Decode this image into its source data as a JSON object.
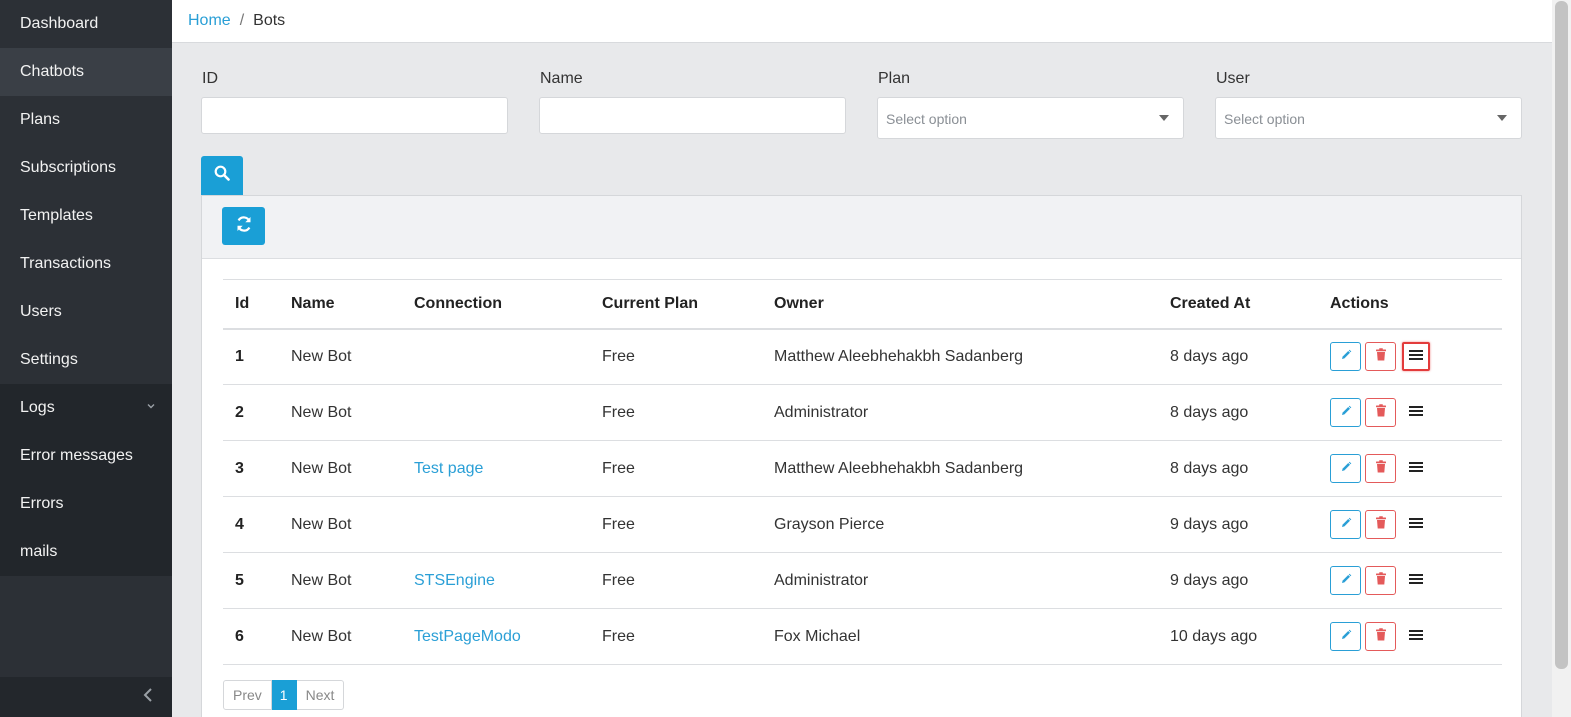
{
  "sidebar": {
    "items": [
      {
        "label": "Dashboard"
      },
      {
        "label": "Chatbots"
      },
      {
        "label": "Plans"
      },
      {
        "label": "Subscriptions"
      },
      {
        "label": "Templates"
      },
      {
        "label": "Transactions"
      },
      {
        "label": "Users"
      },
      {
        "label": "Settings"
      },
      {
        "label": "Logs"
      },
      {
        "label": "Error messages"
      },
      {
        "label": "Errors"
      },
      {
        "label": "mails"
      }
    ],
    "active": "Chatbots"
  },
  "breadcrumb": {
    "home": "Home",
    "separator": "/",
    "current": "Bots"
  },
  "filters": {
    "id_label": "ID",
    "id_value": "",
    "name_label": "Name",
    "name_value": "",
    "plan_label": "Plan",
    "plan_placeholder": "Select option",
    "user_label": "User",
    "user_placeholder": "Select option"
  },
  "table": {
    "headers": {
      "id": "Id",
      "name": "Name",
      "connection": "Connection",
      "plan": "Current Plan",
      "owner": "Owner",
      "created": "Created At",
      "actions": "Actions"
    },
    "rows": [
      {
        "id": "1",
        "name": "New Bot",
        "connection": "",
        "plan": "Free",
        "owner": "Matthew Aleebhehakbh Sadanberg",
        "created": "8 days ago"
      },
      {
        "id": "2",
        "name": "New Bot",
        "connection": "",
        "plan": "Free",
        "owner": "Administrator",
        "created": "8 days ago"
      },
      {
        "id": "3",
        "name": "New Bot",
        "connection": "Test page",
        "plan": "Free",
        "owner": "Matthew Aleebhehakbh Sadanberg",
        "created": "8 days ago"
      },
      {
        "id": "4",
        "name": "New Bot",
        "connection": "",
        "plan": "Free",
        "owner": "Grayson Pierce",
        "created": "9 days ago"
      },
      {
        "id": "5",
        "name": "New Bot",
        "connection": "STSEngine",
        "plan": "Free",
        "owner": "Administrator",
        "created": "9 days ago"
      },
      {
        "id": "6",
        "name": "New Bot",
        "connection": "TestPageModo",
        "plan": "Free",
        "owner": "Fox Michael",
        "created": "10 days ago"
      }
    ]
  },
  "pagination": {
    "prev": "Prev",
    "current": "1",
    "next": "Next"
  },
  "icons": {
    "search": "search-icon",
    "refresh": "refresh-icon",
    "edit": "pencil-icon",
    "delete": "trash-icon",
    "menu": "hamburger-icon",
    "collapse": "chevron-left-icon"
  },
  "colors": {
    "accent": "#1a9fd6",
    "danger": "#e45a5a",
    "sidebar_bg": "#2c3036"
  }
}
